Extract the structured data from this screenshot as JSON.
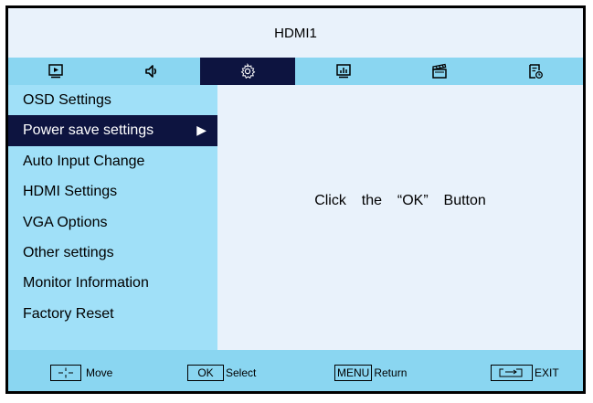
{
  "title": "HDMI1",
  "tabs": [
    {
      "icon": "picture-icon"
    },
    {
      "icon": "speaker-icon"
    },
    {
      "icon": "gear-icon"
    },
    {
      "icon": "chart-icon"
    },
    {
      "icon": "clapperboard-icon"
    },
    {
      "icon": "schedule-icon"
    }
  ],
  "menu": {
    "items": [
      {
        "label": "OSD Settings"
      },
      {
        "label": "Power save settings",
        "arrow": "▶"
      },
      {
        "label": "Auto Input Change"
      },
      {
        "label": "HDMI Settings"
      },
      {
        "label": "VGA Options"
      },
      {
        "label": "Other settings"
      },
      {
        "label": "Monitor Information"
      },
      {
        "label": "Factory Reset"
      }
    ]
  },
  "content": {
    "hint": "Click  the  “OK”  Button"
  },
  "footer": {
    "move_label": "Move",
    "ok_key": "OK",
    "select_label": "Select",
    "menu_key": "MENU",
    "return_label": "Return",
    "exit_label": "EXIT"
  },
  "colors": {
    "accent": "#0d1440",
    "tab_bg": "#8ad6f1",
    "menu_bg": "#a0e0f8",
    "panel_bg": "#e9f2fb"
  }
}
